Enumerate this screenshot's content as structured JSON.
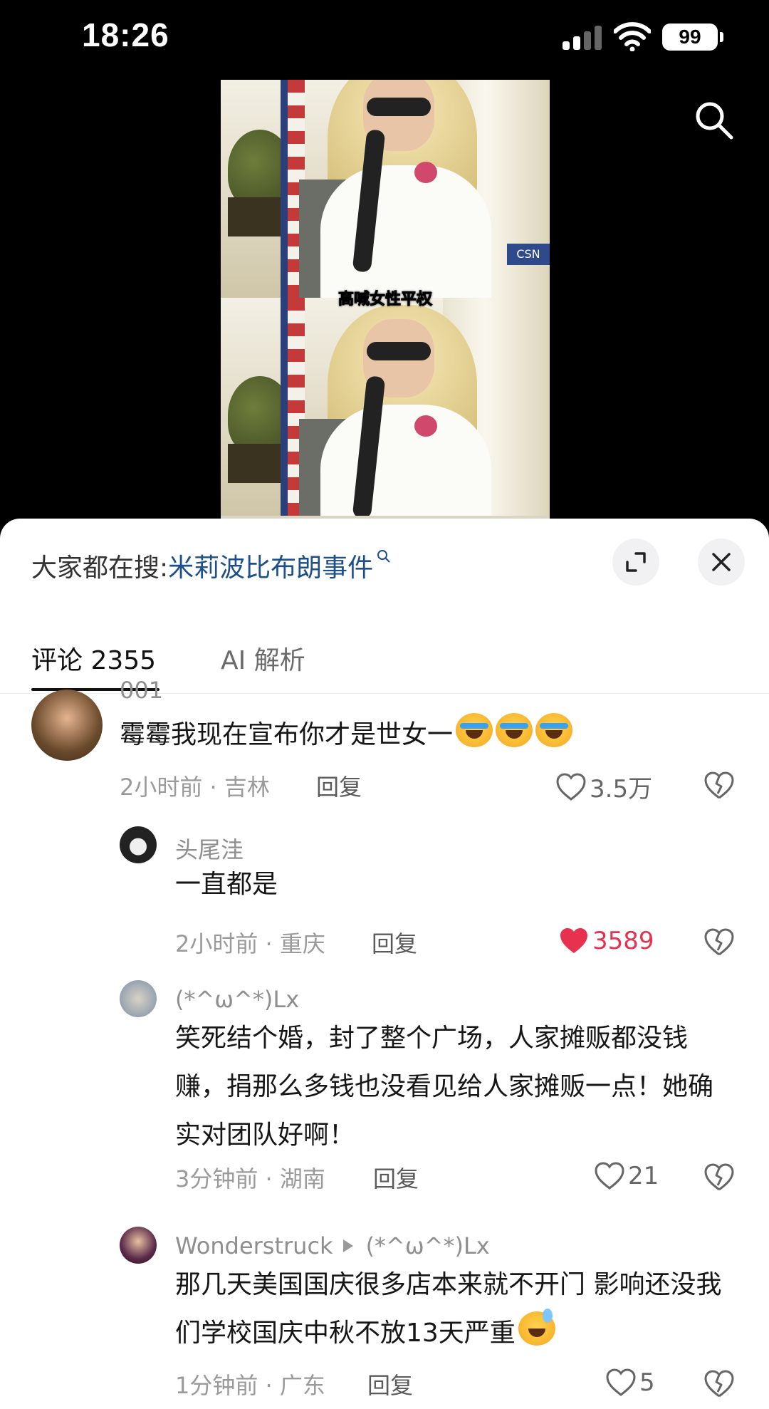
{
  "status_bar": {
    "time": "18:26",
    "battery": "99"
  },
  "video": {
    "caption": "高喊女性平权"
  },
  "header": {
    "hot_search_prefix": "大家都在搜:",
    "hot_search_term": "米莉波比布朗事件"
  },
  "tabs": {
    "comments": "评论 2355",
    "ai": "AI 解析"
  },
  "comments": [
    {
      "username": "001",
      "text": "霉霉我现在宣布你才是世女一",
      "meta": "2小时前 · 吉林",
      "reply": "回复",
      "likes": "3.5万",
      "liked": false
    },
    {
      "username": "头尾洼",
      "text": "一直都是",
      "meta": "2小时前 · 重庆",
      "reply": "回复",
      "likes": "3589",
      "liked": true
    },
    {
      "username": "(*^ω^*)Lx",
      "text": "笑死结个婚，封了整个广场，人家摊贩都没钱赚，捐那么多钱也没看见给人家摊贩一点！她确实对团队好啊！",
      "meta": "3分钟前 · 湖南",
      "reply": "回复",
      "likes": "21",
      "liked": false
    },
    {
      "username": "Wonderstruck",
      "reply_to": "(*^ω^*)Lx",
      "text": "那几天美国国庆很多店本来就不开门 影响还没我们学校国庆中秋不放13天严重",
      "meta": "1分钟前 · 广东",
      "reply": "回复",
      "likes": "5",
      "liked": false
    }
  ],
  "colors": {
    "link": "#1d4f8b",
    "like_active": "#e8304f"
  },
  "icons": [
    "search-icon",
    "expand-icon",
    "close-icon",
    "heart-icon",
    "dislike-icon"
  ]
}
